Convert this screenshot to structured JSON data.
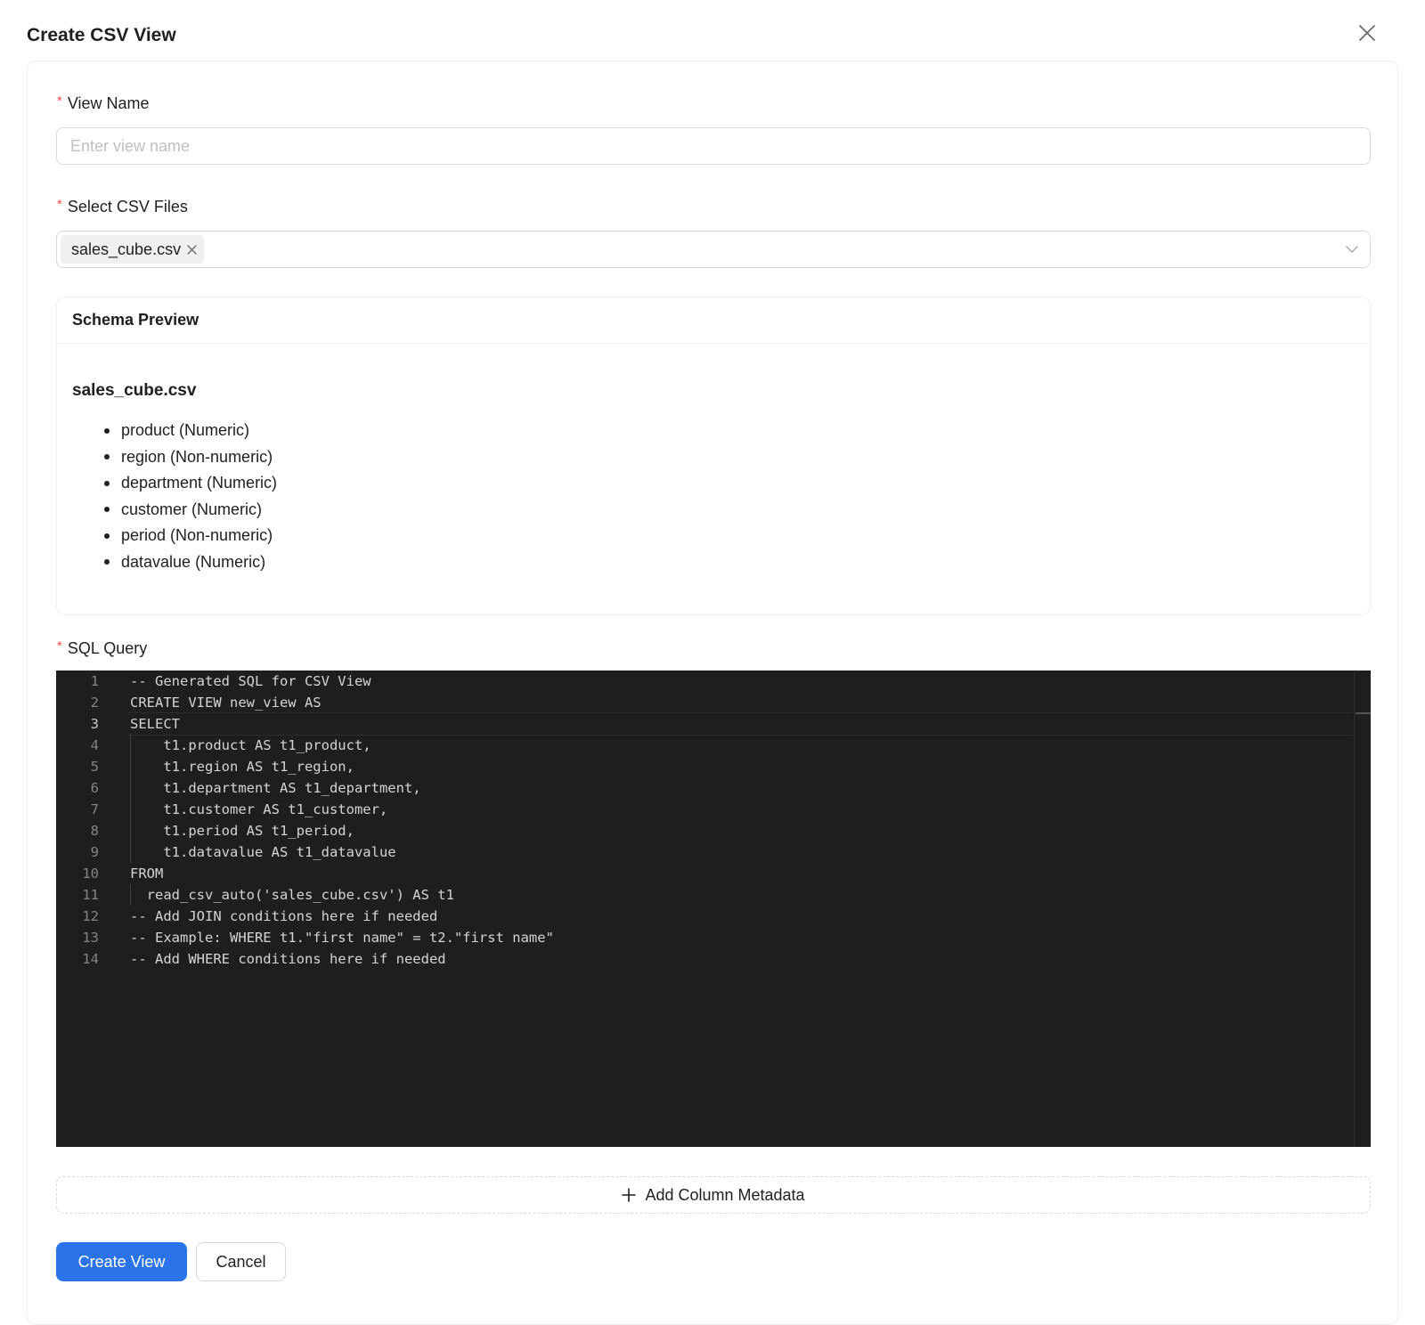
{
  "modal": {
    "title": "Create CSV View"
  },
  "fields": {
    "view_name": {
      "label": "View Name",
      "required_mark": "*",
      "placeholder": "Enter view name",
      "value": ""
    },
    "csv_files": {
      "label": "Select CSV Files",
      "required_mark": "*",
      "selected": [
        "sales_cube.csv"
      ]
    },
    "sql_query": {
      "label": "SQL Query",
      "required_mark": "*"
    }
  },
  "schema_preview": {
    "title": "Schema Preview",
    "file": "sales_cube.csv",
    "columns": [
      "product (Numeric)",
      "region (Non-numeric)",
      "department (Numeric)",
      "customer (Numeric)",
      "period (Non-numeric)",
      "datavalue (Numeric)"
    ]
  },
  "editor": {
    "active_line": 3,
    "lines": [
      {
        "n": "1",
        "text": "-- Generated SQL for CSV View"
      },
      {
        "n": "2",
        "text": "CREATE VIEW new_view AS"
      },
      {
        "n": "3",
        "text": "SELECT"
      },
      {
        "n": "4",
        "text": "    t1.product AS t1_product,"
      },
      {
        "n": "5",
        "text": "    t1.region AS t1_region,"
      },
      {
        "n": "6",
        "text": "    t1.department AS t1_department,"
      },
      {
        "n": "7",
        "text": "    t1.customer AS t1_customer,"
      },
      {
        "n": "8",
        "text": "    t1.period AS t1_period,"
      },
      {
        "n": "9",
        "text": "    t1.datavalue AS t1_datavalue"
      },
      {
        "n": "10",
        "text": "FROM"
      },
      {
        "n": "11",
        "text": "  read_csv_auto('sales_cube.csv') AS t1"
      },
      {
        "n": "12",
        "text": "-- Add JOIN conditions here if needed"
      },
      {
        "n": "13",
        "text": "-- Example: WHERE t1.\"first name\" = t2.\"first name\""
      },
      {
        "n": "14",
        "text": "-- Add WHERE conditions here if needed"
      }
    ]
  },
  "actions": {
    "add_metadata": "Add Column Metadata",
    "create": "Create View",
    "cancel": "Cancel"
  },
  "colors": {
    "primary": "#2b73e8",
    "required": "#ff4d4f",
    "editor_bg": "#1e1e1e"
  }
}
